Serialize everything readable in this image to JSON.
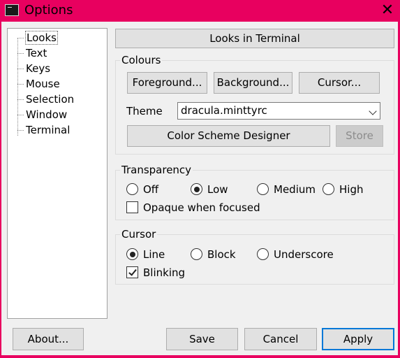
{
  "window": {
    "title": "Options",
    "icon": "terminal-icon",
    "close_glyph": "✕",
    "accent_color": "#e8005f"
  },
  "tree": {
    "items": [
      {
        "label": "Looks",
        "selected": true
      },
      {
        "label": "Text"
      },
      {
        "label": "Keys"
      },
      {
        "label": "Mouse"
      },
      {
        "label": "Selection"
      },
      {
        "label": "Window"
      },
      {
        "label": "Terminal"
      }
    ]
  },
  "panel": {
    "header": "Looks in Terminal"
  },
  "colours": {
    "label": "Colours",
    "foreground_button": "Foreground...",
    "background_button": "Background...",
    "cursor_button": "Cursor...",
    "theme_label": "Theme",
    "theme_value": "dracula.minttyrc",
    "designer_button": "Color Scheme Designer",
    "store_button": "Store"
  },
  "transparency": {
    "label": "Transparency",
    "options": [
      "Off",
      "Low",
      "Medium",
      "High"
    ],
    "selected": "Low",
    "opaque_label": "Opaque when focused",
    "opaque_checked": false
  },
  "cursor": {
    "label": "Cursor",
    "options": [
      "Line",
      "Block",
      "Underscore"
    ],
    "selected": "Line",
    "blinking_label": "Blinking",
    "blinking_checked": true
  },
  "footer": {
    "about_button": "About...",
    "save_button": "Save",
    "cancel_button": "Cancel",
    "apply_button": "Apply"
  }
}
